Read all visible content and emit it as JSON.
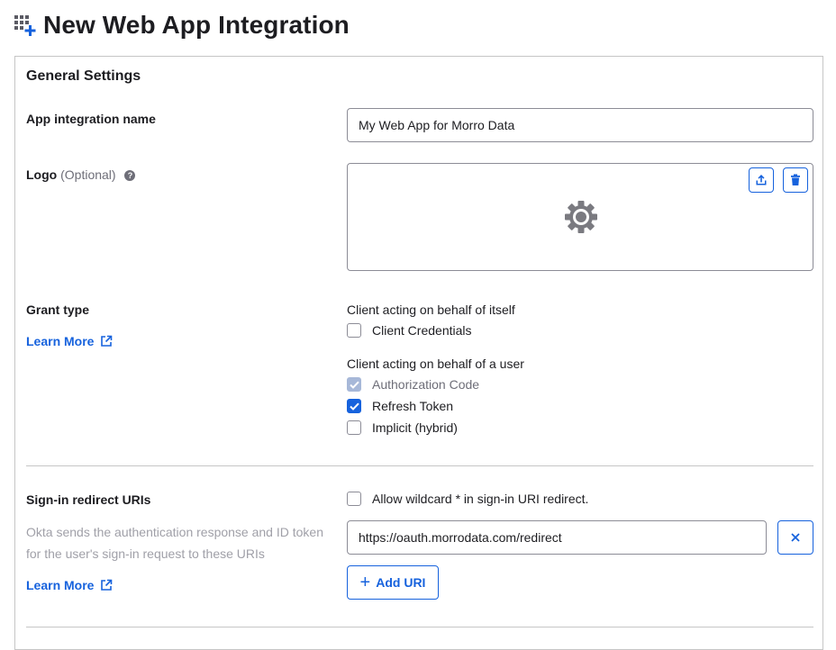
{
  "page": {
    "title": "New Web App Integration"
  },
  "panel": {
    "title": "General Settings"
  },
  "app_name": {
    "label": "App integration name",
    "value": "My Web App for Morro Data"
  },
  "logo": {
    "label": "Logo",
    "optional": "(Optional)",
    "help": "?"
  },
  "grant_type": {
    "label": "Grant type",
    "learn_more": "Learn More",
    "group1_title": "Client acting on behalf of itself",
    "client_credentials": "Client Credentials",
    "group2_title": "Client acting on behalf of a user",
    "authorization_code": "Authorization Code",
    "refresh_token": "Refresh Token",
    "implicit": "Implicit (hybrid)"
  },
  "checkbox_states": {
    "client_credentials": false,
    "authorization_code": true,
    "refresh_token": true,
    "implicit": false,
    "allow_wildcard": false
  },
  "redirect": {
    "label": "Sign-in redirect URIs",
    "allow_wildcard": "Allow wildcard * in sign-in URI redirect.",
    "description": "Okta sends the authentication response and ID token for the user's sign-in request to these URIs",
    "learn_more": "Learn More",
    "uri_value": "https://oauth.morrodata.com/redirect",
    "add_uri": "Add URI"
  },
  "colors": {
    "accent": "#1662dd",
    "border": "#c6c6c6",
    "muted": "#6e6e78"
  }
}
